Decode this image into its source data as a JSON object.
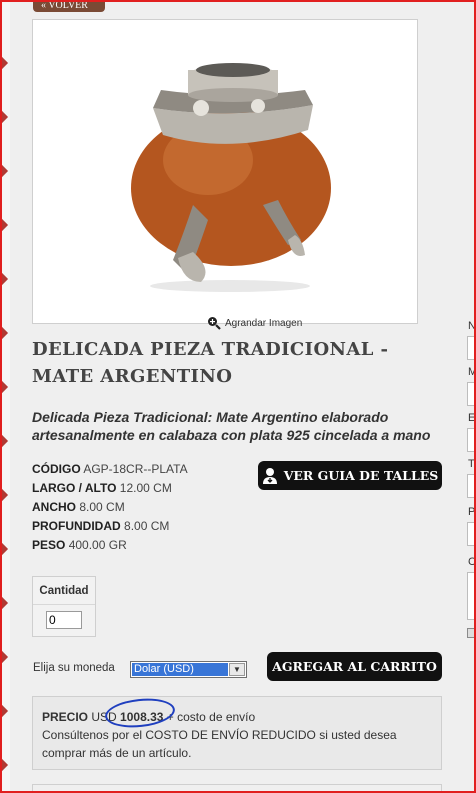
{
  "nav": {
    "back_label": "« Volver"
  },
  "product": {
    "image_alt": "Mate de calabaza con plata cincelada",
    "zoom_label": "Agrandar Imagen",
    "title": "DELICADA PIEZA TRADICIONAL - MATE ARGENTINO",
    "subtitle": "Delicada Pieza Tradicional: Mate Argentino elaborado artesanalmente en calabaza con plata 925 cincelada a mano",
    "specs": [
      {
        "key": "CÓDIGO",
        "value": "AGP-18CR--PLATA"
      },
      {
        "key": "LARGO / ALTO",
        "value": "12.00 CM"
      },
      {
        "key": "ANCHO",
        "value": "8.00 CM"
      },
      {
        "key": "PROFUNDIDAD",
        "value": "8.00 CM"
      },
      {
        "key": "PESO",
        "value": "400.00 GR"
      }
    ]
  },
  "buttons": {
    "size_guide": "VER GUIA DE TALLES",
    "add_to_cart": "AGREGAR AL CARRITO"
  },
  "quantity": {
    "label": "Cantidad",
    "value": "0"
  },
  "currency": {
    "label": "Elija su moneda",
    "selected": "Dolar (USD)"
  },
  "price": {
    "label": "PRECIO",
    "currency": "USD",
    "amount": "1008.33",
    "suffix": "+ costo de envío",
    "note": "Consúltenos por el COSTO DE ENVÍO REDUCIDO si usted desea comprar más de un artículo."
  },
  "side_form": {
    "letters": [
      "N",
      "M",
      "E",
      "T",
      "P",
      "C"
    ]
  },
  "colors": {
    "accent_button": "#111111",
    "frame": "#e11f1f",
    "annotation": "#1f3fbf"
  }
}
